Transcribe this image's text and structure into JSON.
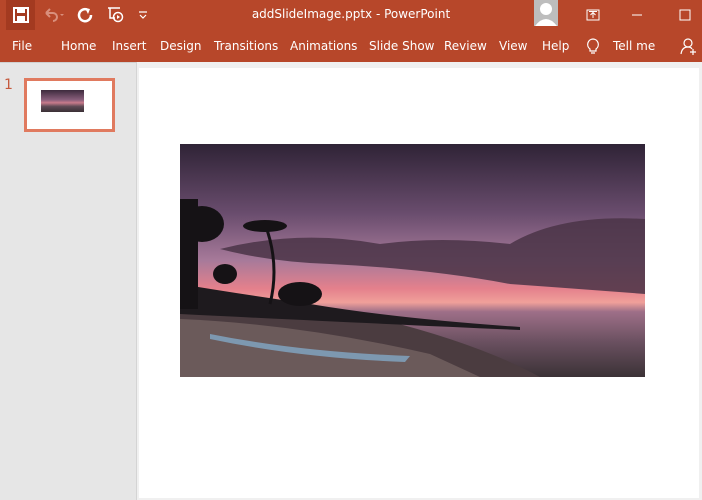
{
  "window": {
    "title": "addSlideImage.pptx  -  PowerPoint",
    "accent": "#b7472a"
  },
  "quick_access": [
    {
      "icon": "save-icon"
    },
    {
      "icon": "undo-icon"
    },
    {
      "icon": "redo-icon"
    },
    {
      "icon": "slideshow-from-start-icon"
    },
    {
      "icon": "customize-dropdown-icon"
    }
  ],
  "ribbon": {
    "tabs": [
      "File",
      "Home",
      "Insert",
      "Design",
      "Transitions",
      "Animations",
      "Slide Show",
      "Review",
      "View",
      "Help"
    ],
    "tell_me": "Tell me"
  },
  "slides_panel": {
    "slides": [
      {
        "number": "1",
        "selected": true
      }
    ]
  },
  "slide": {
    "content": "beach sunset image with palm trees and boats"
  }
}
